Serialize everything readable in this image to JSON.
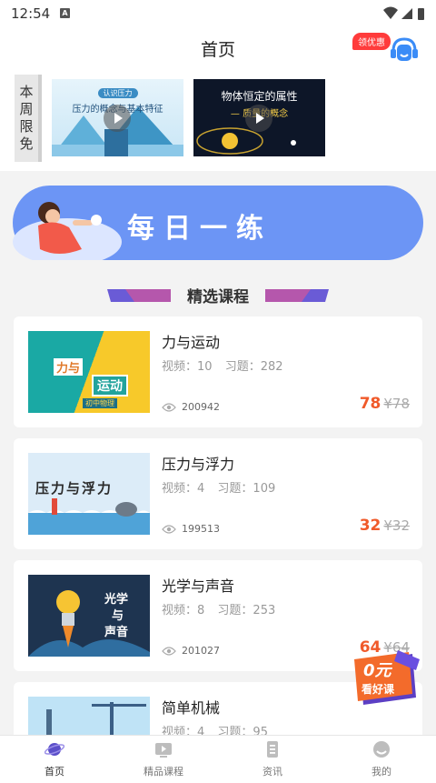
{
  "status_bar": {
    "time": "12:54",
    "notif_glyph": "A"
  },
  "header": {
    "title": "首页",
    "coupon_label": "领优惠",
    "service_icon": "customer-service-icon"
  },
  "free_section": {
    "label_chars": [
      "本",
      "周",
      "限",
      "免"
    ],
    "videos": [
      {
        "tag": "认识压力",
        "title": "压力的概念与基本特征"
      },
      {
        "title_line1": "物体恒定的属性",
        "title_line2": "— 质量的概念"
      }
    ]
  },
  "daily_banner": {
    "text": "每日一练"
  },
  "section": {
    "title": "精选课程"
  },
  "courses": [
    {
      "title": "力与运动",
      "video_label": "视频：10",
      "exercise_label": "习题：282",
      "views": "200942",
      "price": "78",
      "original_price": "¥78",
      "thumb_text1": "力与",
      "thumb_text2": "运动",
      "thumb_tag": "初中物理"
    },
    {
      "title": "压力与浮力",
      "video_label": "视频：4",
      "exercise_label": "习题：109",
      "views": "199513",
      "price": "32",
      "original_price": "¥32",
      "thumb_text1": "压力与浮力"
    },
    {
      "title": "光学与声音",
      "video_label": "视频：8",
      "exercise_label": "习题：253",
      "views": "201027",
      "price": "64",
      "original_price": "¥64",
      "thumb_text1": "光学",
      "thumb_text2": "与",
      "thumb_text3": "声音"
    },
    {
      "title": "简单机械",
      "video_label": "视频：4",
      "exercise_label": "习题：95"
    }
  ],
  "promo": {
    "line1": "0元",
    "line2": "看好课"
  },
  "tabs": [
    {
      "label": "首页",
      "icon": "planet-icon"
    },
    {
      "label": "精品课程",
      "icon": "video-icon"
    },
    {
      "label": "资讯",
      "icon": "document-icon"
    },
    {
      "label": "我的",
      "icon": "profile-icon"
    }
  ],
  "colors": {
    "accent": "#f05a2a",
    "banner_blue": "#6c95f5",
    "tab_active": "#5b4fc9"
  }
}
